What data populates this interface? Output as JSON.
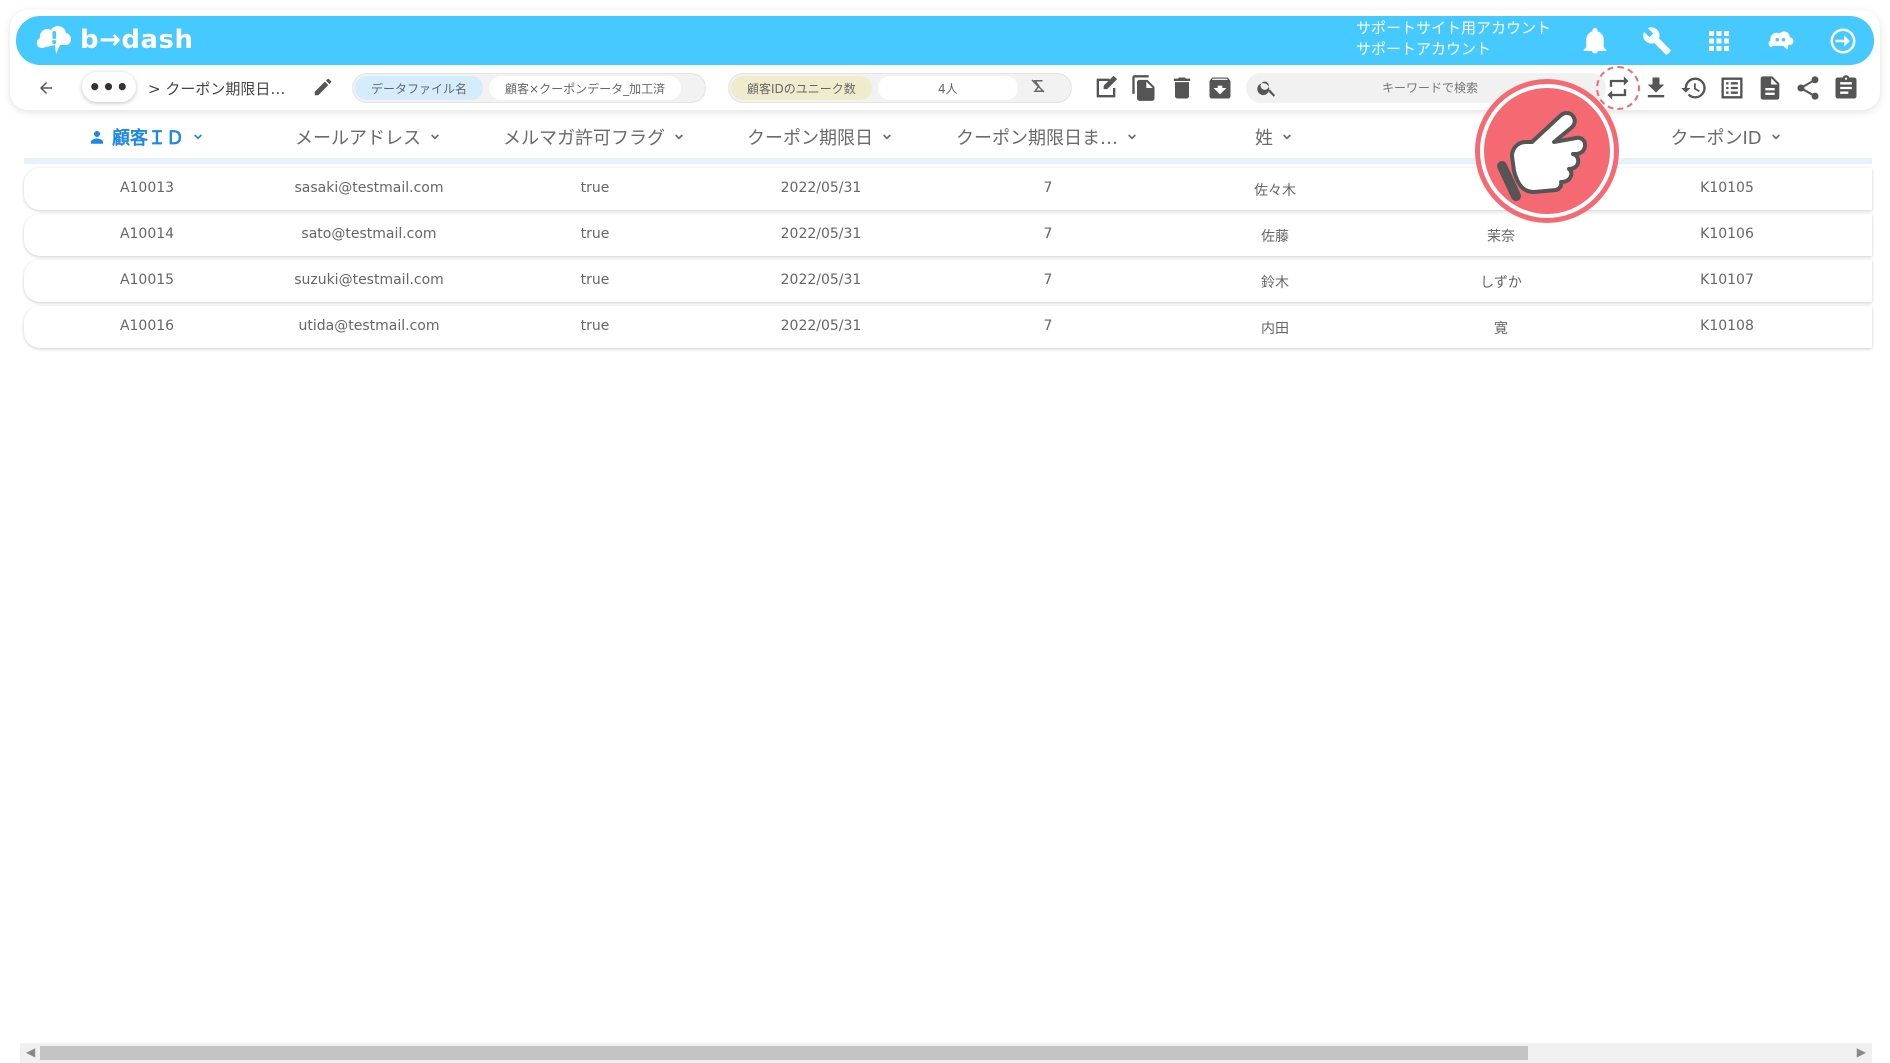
{
  "app": {
    "logo_text": "b→dash",
    "account_line1": "サポートサイト用アカウント",
    "account_line2": "サポートアカウント"
  },
  "toolbar": {
    "more_label": "•••",
    "breadcrumb": "> クーポン期限日…",
    "datafile_label": "データファイル名",
    "datafile_value": "顧客×クーポンデータ_加工済",
    "unique_label": "顧客IDのユニーク数",
    "unique_value": "4人",
    "search_placeholder": "キーワードで検索"
  },
  "columns": [
    {
      "label": "顧客ＩＤ",
      "active": true
    },
    {
      "label": "メールアドレス",
      "active": false
    },
    {
      "label": "メルマガ許可フラグ",
      "active": false
    },
    {
      "label": "クーポン期限日",
      "active": false
    },
    {
      "label": "クーポン期限日ま…",
      "active": false
    },
    {
      "label": "姓",
      "active": false
    },
    {
      "label": "",
      "active": false
    },
    {
      "label": "クーポンID",
      "active": false
    }
  ],
  "rows": [
    [
      "A10013",
      "sasaki@testmail.com",
      "true",
      "2022/05/31",
      "7",
      "佐々木",
      "",
      "K10105"
    ],
    [
      "A10014",
      "sato@testmail.com",
      "true",
      "2022/05/31",
      "7",
      "佐藤",
      "茉奈",
      "K10106"
    ],
    [
      "A10015",
      "suzuki@testmail.com",
      "true",
      "2022/05/31",
      "7",
      "鈴木",
      "しずか",
      "K10107"
    ],
    [
      "A10016",
      "utida@testmail.com",
      "true",
      "2022/05/31",
      "7",
      "内田",
      "寛",
      "K10108"
    ]
  ],
  "colors": {
    "header_bar": "#45c9ff",
    "active_column": "#1e88e5",
    "highlight": "#f56a72"
  },
  "icons": {
    "top": [
      "bell-icon",
      "wrench-icon",
      "apps-grid-icon",
      "chat-bot-icon",
      "logout-icon"
    ],
    "actions": [
      "edit-note-icon",
      "copy-icon",
      "delete-icon",
      "archive-icon"
    ],
    "right": [
      "sync-icon",
      "download-icon",
      "history-icon",
      "list-icon",
      "document-icon",
      "share-icon",
      "clipboard-icon"
    ]
  }
}
